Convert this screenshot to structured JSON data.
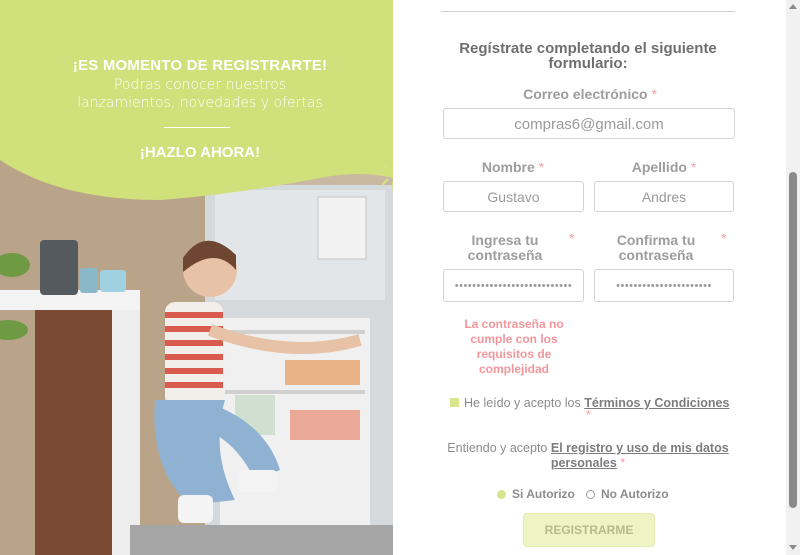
{
  "promo": {
    "headline": "¡ES MOMENTO DE REGISTRARTE!",
    "subline_1": "Podras conocer nuestros",
    "subline_2": "lanzamientos, novedades y ofertas",
    "cta": "¡HAZLO AHORA!",
    "brand_color": "#d0e07a",
    "photo_description_icon": "refrigerator-photo"
  },
  "form": {
    "intro": "Regístrate completando el siguiente formulario:",
    "required_mark": "*",
    "email_label": "Correo electrónico",
    "email_value": "compras6@gmail.com",
    "first_name_label": "Nombre",
    "first_name_value": "Gustavo",
    "last_name_label": "Apellido",
    "last_name_value": "Andres",
    "password_label_1": "Ingresa tu",
    "password_label_2": "contraseña",
    "password_value": "•••••••••••••••••••••••••••",
    "confirm_label_1": "Confirma tu",
    "confirm_label_2": "contraseña",
    "confirm_value": "••••••••••••••••••••••",
    "password_error": "La contraseña no cumple con los requisitos de complejidad",
    "terms_prefix": "He leído y acepto los",
    "terms_link": "Términos y Condiciones",
    "data_prefix": "Entiendo y acepto",
    "data_link": "El registro y uso de mis datos personales",
    "radio_yes": "Si Autorizo",
    "radio_no": "No Autorizo",
    "radio_selected": "Si Autorizo",
    "submit_label": "REGISTRARME",
    "accent_color": "#d7e58c",
    "error_color": "#f2969c"
  }
}
